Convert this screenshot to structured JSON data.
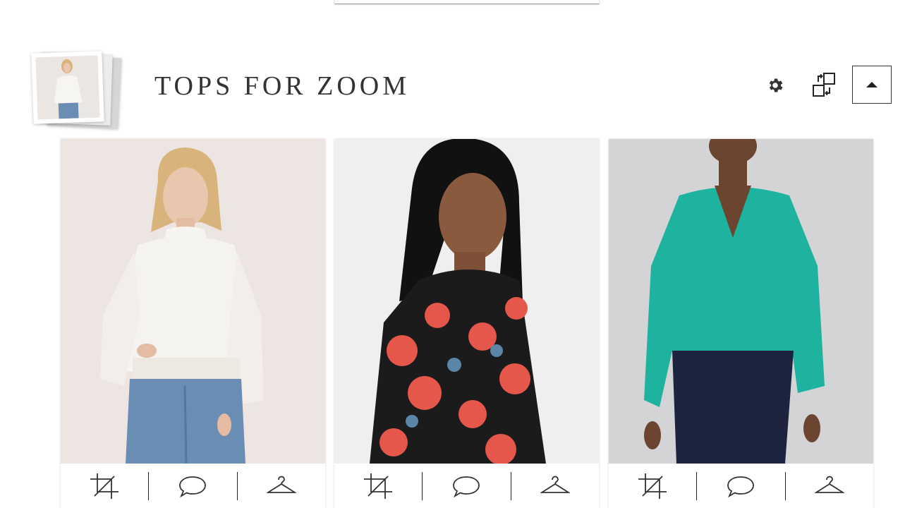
{
  "board": {
    "title": "TOPS FOR ZOOM"
  },
  "header_icons": {
    "settings": "gear-icon",
    "swap": "swap-arrange-icon",
    "collapse": "caret-up-icon"
  },
  "products": [
    {
      "image": "white-ruffle-neck-blouse",
      "colors": {
        "bg": "#ece5e1",
        "top": "#f5f3ef",
        "bottom": "#6a8db3",
        "skin": "#e9c6ae",
        "hair": "#d9b37c"
      }
    },
    {
      "image": "black-floral-print-shirt",
      "colors": {
        "bg": "#efefef",
        "top": "#1b1b1b",
        "accent": "#e4574a",
        "skin": "#8a5a3e",
        "hair": "#111111"
      }
    },
    {
      "image": "teal-wrap-blouse",
      "colors": {
        "bg": "#d4d4d6",
        "top": "#1eb39e",
        "bottom": "#1c2440",
        "skin": "#6b452f",
        "hair": "#2a1b12"
      }
    }
  ],
  "card_actions": [
    "crop-icon",
    "comment-icon",
    "hanger-icon"
  ]
}
